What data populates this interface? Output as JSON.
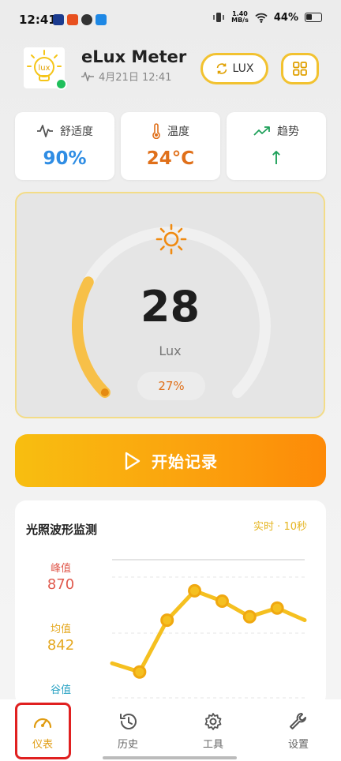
{
  "status_bar": {
    "time": "12:41",
    "speed_value": "1.40",
    "speed_unit": "MB/s",
    "battery": "44%"
  },
  "header": {
    "title": "eLux Meter",
    "subtitle": "4月21日 12:41",
    "logo_text": "lux",
    "mode_button_label": "LUX",
    "status_color": "#1fbf5b"
  },
  "stats": [
    {
      "label": "舒适度",
      "value": "90%",
      "icon": "pulse-icon",
      "color": "#2f8de4"
    },
    {
      "label": "温度",
      "value": "24°C",
      "icon": "thermometer-icon",
      "color": "#e0701a"
    },
    {
      "label": "趋势",
      "value": "↑",
      "icon": "trend-up-icon",
      "color": "#1fa05a"
    }
  ],
  "gauge": {
    "value": "28",
    "unit": "Lux",
    "percent": "27%",
    "fraction": 0.27,
    "icon": "sun-icon",
    "accent": "#f7b733"
  },
  "record": {
    "label": "开始记录",
    "icon": "play-icon"
  },
  "waveform": {
    "title": "光照波形监测",
    "badge": "实时 · 10秒",
    "peak_label": "峰值",
    "peak_value": "870",
    "avg_label": "均值",
    "avg_value": "842",
    "min_label": "谷值",
    "points": [
      820,
      815,
      845,
      862,
      856,
      847,
      852,
      845
    ],
    "peak_color": "#e05a4e",
    "avg_color": "#e5a820",
    "min_color": "#2ba3c4"
  },
  "nav": {
    "items": [
      {
        "label": "仪表",
        "icon": "gauge-icon"
      },
      {
        "label": "历史",
        "icon": "history-icon"
      },
      {
        "label": "工具",
        "icon": "gear-icon"
      },
      {
        "label": "设置",
        "icon": "wrench-icon"
      }
    ],
    "active_index": 0
  }
}
